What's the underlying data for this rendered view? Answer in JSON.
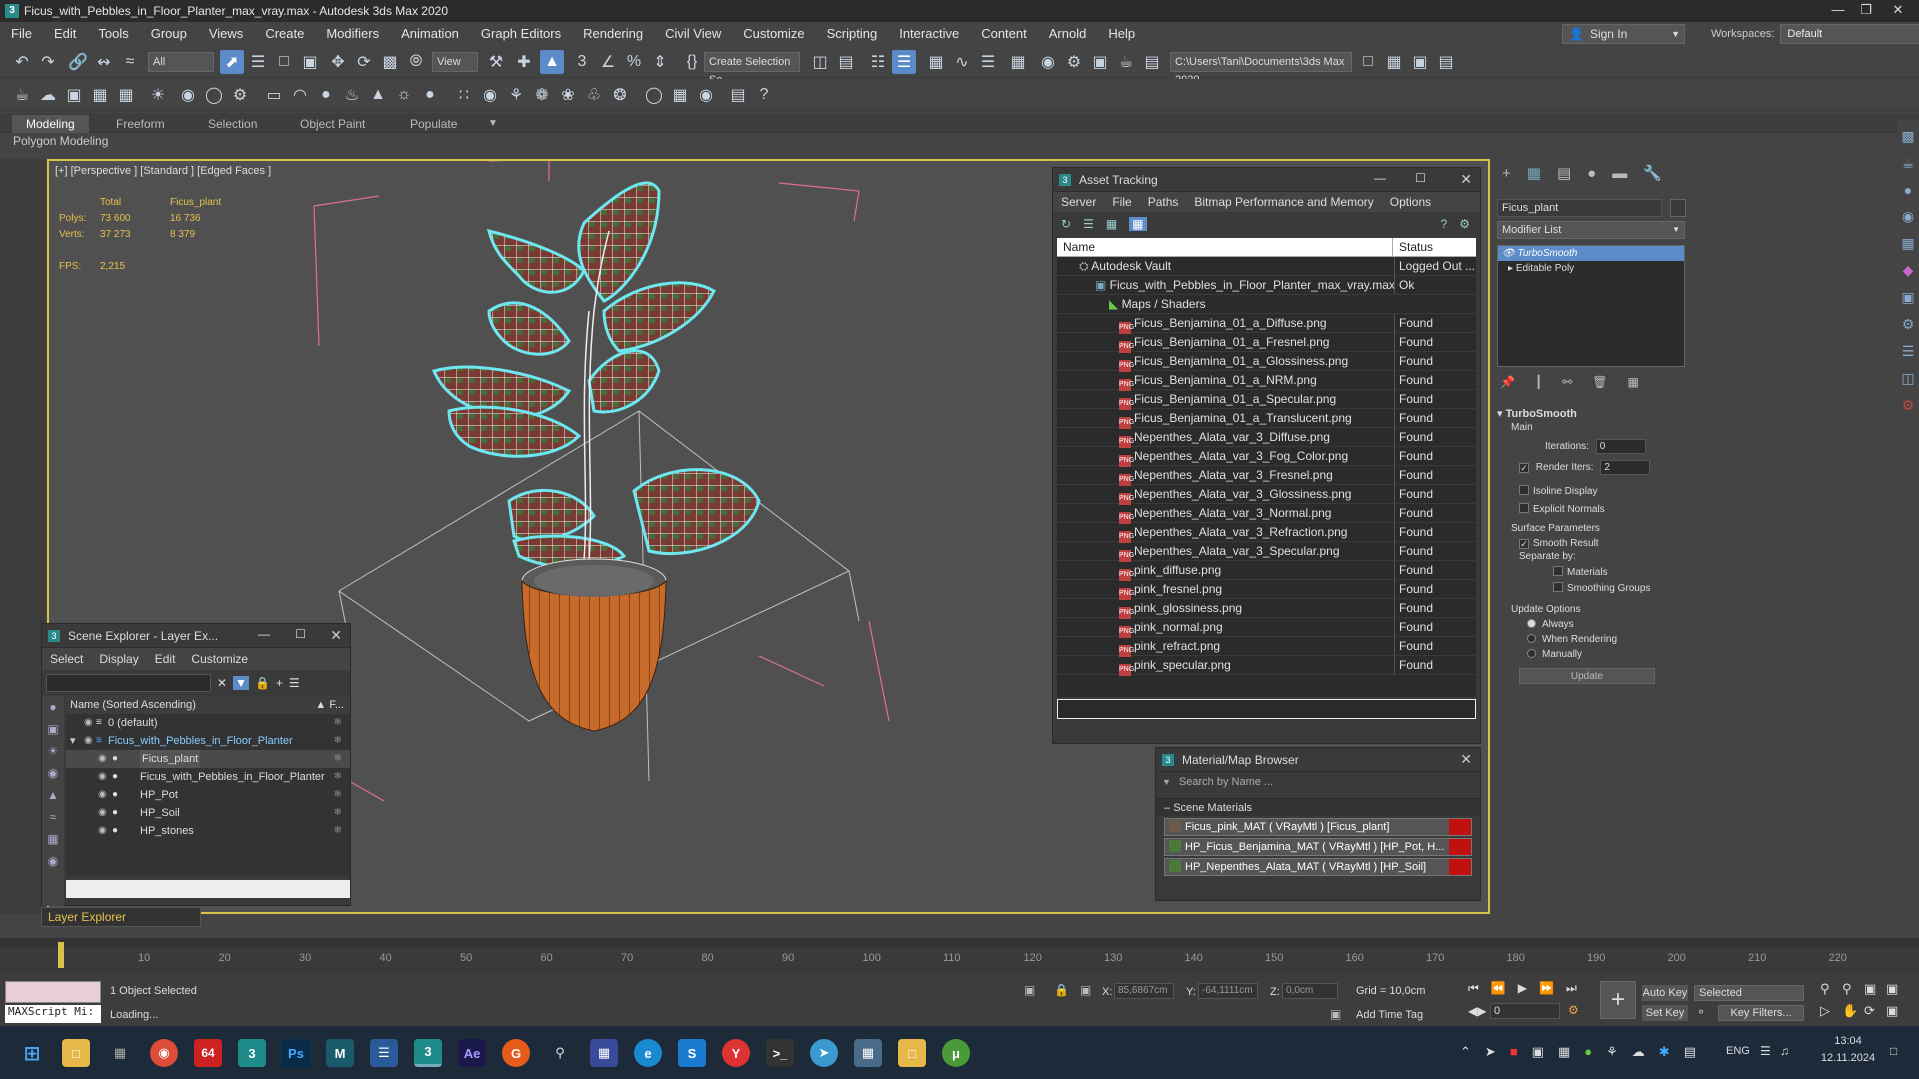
{
  "window": {
    "title": "Ficus_with_Pebbles_in_Floor_Planter_max_vray.max - Autodesk 3ds Max 2020",
    "minimize": "—",
    "maximize": "❐",
    "close": "✕"
  },
  "menu": [
    "File",
    "Edit",
    "Tools",
    "Group",
    "Views",
    "Create",
    "Modifiers",
    "Animation",
    "Graph Editors",
    "Rendering",
    "Civil View",
    "Customize",
    "Scripting",
    "Interactive",
    "Content",
    "Arnold",
    "Help"
  ],
  "signin": "Sign In",
  "workspaces_label": "Workspaces:",
  "workspaces_value": "Default",
  "toolbar": {
    "filter": "All",
    "view": "View",
    "create_selection": "Create Selection Se",
    "path": "C:\\Users\\Tani\\Documents\\3ds Max 2020"
  },
  "ribbon": {
    "tabs": [
      "Modeling",
      "Freeform",
      "Selection",
      "Object Paint",
      "Populate"
    ],
    "sub": "Polygon Modeling"
  },
  "viewport": {
    "label": "[+] [Perspective ] [Standard ] [Edged Faces ]",
    "stats": {
      "h_total": "Total",
      "h_obj": "Ficus_plant",
      "polys_label": "Polys:",
      "polys_total": "73 600",
      "polys_obj": "16 736",
      "verts_label": "Verts:",
      "verts_total": "37 273",
      "verts_obj": "8 379",
      "fps_label": "FPS:",
      "fps": "2,215"
    }
  },
  "asset_tracking": {
    "title": "Asset Tracking",
    "menu": [
      "Server",
      "File",
      "Paths",
      "Bitmap Performance and Memory",
      "Options"
    ],
    "col_name": "Name",
    "col_status": "Status",
    "rows": [
      {
        "name": "Autodesk Vault",
        "status": "Logged Out ..."
      },
      {
        "name": "Ficus_with_Pebbles_in_Floor_Planter_max_vray.max",
        "status": "Ok"
      },
      {
        "name": "Maps / Shaders",
        "status": ""
      },
      {
        "name": "Ficus_Benjamina_01_a_Diffuse.png",
        "status": "Found"
      },
      {
        "name": "Ficus_Benjamina_01_a_Fresnel.png",
        "status": "Found"
      },
      {
        "name": "Ficus_Benjamina_01_a_Glossiness.png",
        "status": "Found"
      },
      {
        "name": "Ficus_Benjamina_01_a_NRM.png",
        "status": "Found"
      },
      {
        "name": "Ficus_Benjamina_01_a_Specular.png",
        "status": "Found"
      },
      {
        "name": "Ficus_Benjamina_01_a_Translucent.png",
        "status": "Found"
      },
      {
        "name": "Nepenthes_Alata_var_3_Diffuse.png",
        "status": "Found"
      },
      {
        "name": "Nepenthes_Alata_var_3_Fog_Color.png",
        "status": "Found"
      },
      {
        "name": "Nepenthes_Alata_var_3_Fresnel.png",
        "status": "Found"
      },
      {
        "name": "Nepenthes_Alata_var_3_Glossiness.png",
        "status": "Found"
      },
      {
        "name": "Nepenthes_Alata_var_3_Normal.png",
        "status": "Found"
      },
      {
        "name": "Nepenthes_Alata_var_3_Refraction.png",
        "status": "Found"
      },
      {
        "name": "Nepenthes_Alata_var_3_Specular.png",
        "status": "Found"
      },
      {
        "name": "pink_diffuse.png",
        "status": "Found"
      },
      {
        "name": "pink_fresnel.png",
        "status": "Found"
      },
      {
        "name": "pink_glossiness.png",
        "status": "Found"
      },
      {
        "name": "pink_normal.png",
        "status": "Found"
      },
      {
        "name": "pink_refract.png",
        "status": "Found"
      },
      {
        "name": "pink_specular.png",
        "status": "Found"
      }
    ]
  },
  "scene_explorer": {
    "title": "Scene Explorer - Layer Ex...",
    "menu": [
      "Select",
      "Display",
      "Edit",
      "Customize"
    ],
    "col_name": "Name (Sorted Ascending)",
    "col_f": "▲ F...",
    "rows": [
      {
        "name": "0 (default)"
      },
      {
        "name": "Ficus_with_Pebbles_in_Floor_Planter"
      },
      {
        "name": "Ficus_plant"
      },
      {
        "name": "Ficus_with_Pebbles_in_Floor_Planter"
      },
      {
        "name": "HP_Pot"
      },
      {
        "name": "HP_Soil"
      },
      {
        "name": "HP_stones"
      }
    ],
    "footer": "Layer Explorer"
  },
  "material_browser": {
    "title": "Material/Map Browser",
    "search": "Search by Name ...",
    "section": "Scene Materials",
    "items": [
      "Ficus_pink_MAT  ( VRayMtl )  [Ficus_plant]",
      "HP_Ficus_Benjamina_MAT  ( VRayMtl )  [HP_Pot, H...",
      "HP_Nepenthes_Alata_MAT  ( VRayMtl )  [HP_Soil]"
    ]
  },
  "command_panel": {
    "object_name": "Ficus_plant",
    "modifier_list": "Modifier List",
    "stack": [
      "TurboSmooth",
      "Editable Poly"
    ],
    "turbosmooth": {
      "title": "TurboSmooth",
      "main": "Main",
      "iterations_label": "Iterations:",
      "iterations": "0",
      "render_iters_label": "Render Iters:",
      "render_iters": "2",
      "isoline": "Isoline Display",
      "explicit": "Explicit Normals",
      "surface": "Surface Parameters",
      "smooth": "Smooth Result",
      "separate": "Separate by:",
      "materials": "Materials",
      "smoothing": "Smoothing Groups",
      "update_options": "Update Options",
      "always": "Always",
      "when_rendering": "When Rendering",
      "manually": "Manually",
      "update": "Update"
    }
  },
  "timeline": {
    "ticks": [
      "10",
      "20",
      "30",
      "40",
      "50",
      "60",
      "70",
      "80",
      "90",
      "100",
      "110",
      "120",
      "130",
      "140",
      "150",
      "160",
      "170",
      "180",
      "190",
      "200",
      "210",
      "220"
    ]
  },
  "status": {
    "maxscript": "MAXScript Mi:",
    "selected": "1 Object Selected",
    "loading": "Loading...",
    "x_label": "X:",
    "x": "85,6867cm",
    "y_label": "Y:",
    "y": "-64,1111cm",
    "z_label": "Z:",
    "z": "0,0cm",
    "grid": "Grid = 10,0cm",
    "add_time_tag": "Add Time Tag",
    "auto_key": "Auto Key",
    "set_key": "Set Key",
    "selected_dd": "Selected",
    "key_filters": "Key Filters...",
    "frame": "0"
  },
  "taskbar": {
    "lang": "ENG",
    "time": "13:04",
    "date": "12.11.2024",
    "icon64": "64"
  }
}
